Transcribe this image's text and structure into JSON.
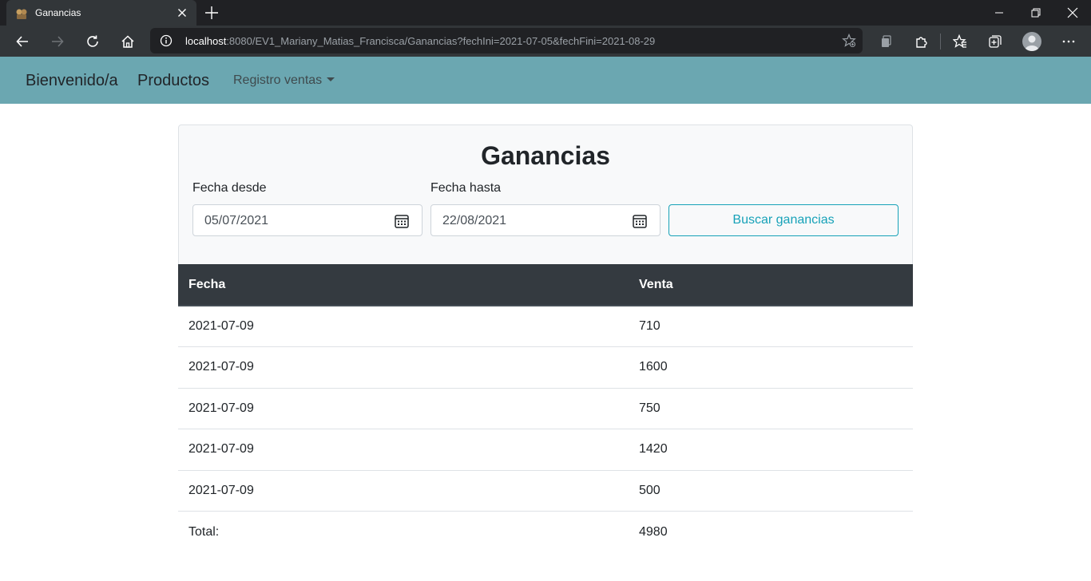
{
  "browser": {
    "tab_title": "Ganancias",
    "url_host": "localhost",
    "url_rest": ":8080/EV1_Mariany_Matias_Francisca/Ganancias?fechIni=2021-07-05&fechFini=2021-08-29"
  },
  "navbar": {
    "brand": "Bienvenido/a",
    "link_productos": "Productos",
    "dropdown_registro": "Registro ventas"
  },
  "form": {
    "title": "Ganancias",
    "desde_label": "Fecha desde",
    "desde_value": "05/07/2021",
    "hasta_label": "Fecha hasta",
    "hasta_value": "22/08/2021",
    "search_button": "Buscar ganancias"
  },
  "table": {
    "headers": [
      "Fecha",
      "Venta"
    ],
    "rows": [
      {
        "fecha": "2021-07-09",
        "venta": "710"
      },
      {
        "fecha": "2021-07-09",
        "venta": "1600"
      },
      {
        "fecha": "2021-07-09",
        "venta": "750"
      },
      {
        "fecha": "2021-07-09",
        "venta": "1420"
      },
      {
        "fecha": "2021-07-09",
        "venta": "500"
      }
    ],
    "total_label": "Total:",
    "total_value": "4980"
  },
  "colors": {
    "navbar": "#6ba7b1",
    "table_header": "#343a40",
    "accent": "#17a2b8"
  }
}
